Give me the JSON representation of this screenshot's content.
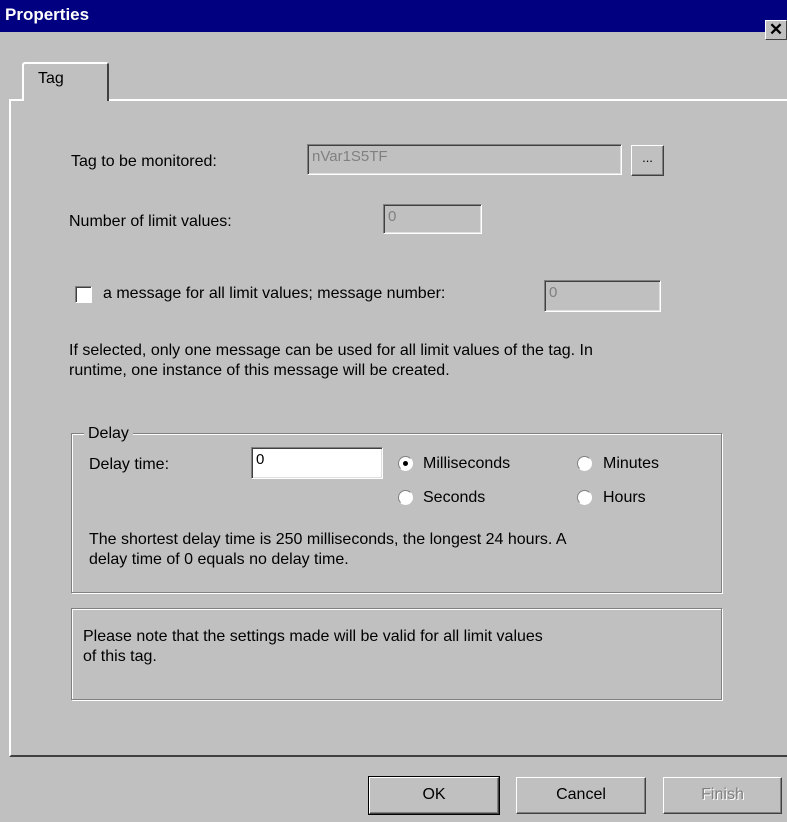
{
  "window": {
    "title": "Properties",
    "close_glyph": "✕"
  },
  "tabs": [
    {
      "label": "Tag",
      "selected": true
    }
  ],
  "tag_monitor": {
    "label": "Tag to be monitored:",
    "value": "nVar1S5TF",
    "browse_label": "..."
  },
  "limit_values": {
    "label": "Number of limit values:",
    "value": "0"
  },
  "message": {
    "checkbox_label": "a message for all limit values; message number:",
    "checked": false,
    "number_value": "0",
    "info_line1": "If selected, only one message can be used for all limit values of the tag. In",
    "info_line2": "runtime, one instance of this message will be created."
  },
  "delay": {
    "group_label": "Delay",
    "time_label": "Delay time:",
    "time_value": "0",
    "units": [
      {
        "label": "Milliseconds",
        "selected": true
      },
      {
        "label": "Minutes",
        "selected": false
      },
      {
        "label": "Seconds",
        "selected": false
      },
      {
        "label": "Hours",
        "selected": false
      }
    ],
    "note_line1": "The shortest delay time is 250 milliseconds, the longest 24 hours. A",
    "note_line2": "delay time of 0 equals no delay time."
  },
  "notice": {
    "line1": "Please note that the settings made will be valid for all limit values",
    "line2": "of this tag."
  },
  "buttons": {
    "ok": "OK",
    "cancel": "Cancel",
    "finish": "Finish"
  }
}
